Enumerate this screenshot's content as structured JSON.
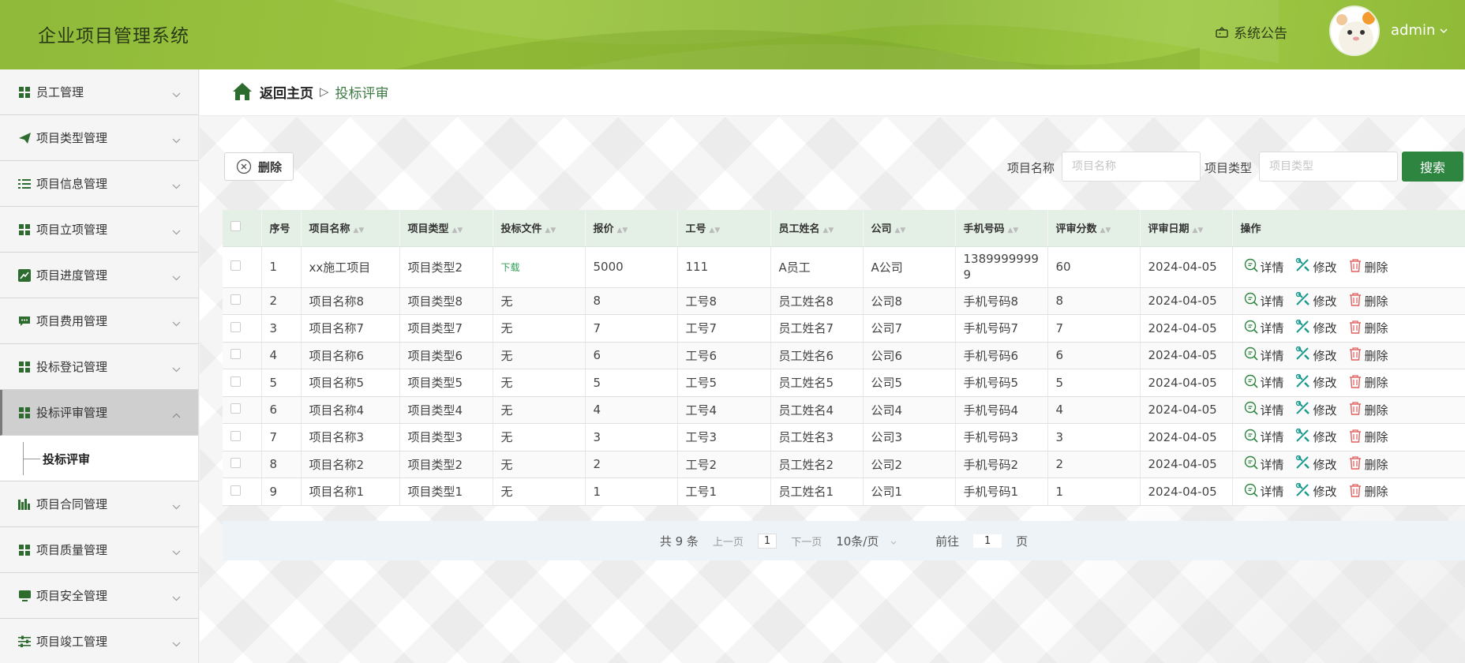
{
  "header": {
    "app_title": "企业项目管理系统",
    "notice": "系统公告",
    "username": "admin"
  },
  "sidebar": {
    "items": [
      {
        "label": "员工管理",
        "icon": "grid-icon"
      },
      {
        "label": "项目类型管理",
        "icon": "paper-plane-icon"
      },
      {
        "label": "项目信息管理",
        "icon": "list-icon"
      },
      {
        "label": "项目立项管理",
        "icon": "grid-icon"
      },
      {
        "label": "项目进度管理",
        "icon": "line-chart-icon"
      },
      {
        "label": "项目费用管理",
        "icon": "chat-icon"
      },
      {
        "label": "投标登记管理",
        "icon": "grid-icon"
      },
      {
        "label": "投标评审管理",
        "icon": "grid-icon"
      },
      {
        "label": "项目合同管理",
        "icon": "bar-chart-icon"
      },
      {
        "label": "项目质量管理",
        "icon": "grid-icon"
      },
      {
        "label": "项目安全管理",
        "icon": "monitor-icon"
      },
      {
        "label": "项目竣工管理",
        "icon": "sliders-icon"
      }
    ],
    "active_submenu": "投标评审"
  },
  "breadcrumb": {
    "home": "返回主页",
    "separator": "▷",
    "current": "投标评审"
  },
  "toolbar": {
    "delete_label": "删除",
    "name_label": "项目名称",
    "name_placeholder": "项目名称",
    "type_label": "项目类型",
    "type_placeholder": "项目类型",
    "search_label": "搜索"
  },
  "table": {
    "columns": [
      "序号",
      "项目名称",
      "项目类型",
      "投标文件",
      "报价",
      "工号",
      "员工姓名",
      "公司",
      "手机号码",
      "评审分数",
      "评审日期",
      "操作"
    ],
    "rows": [
      {
        "no": "1",
        "name": "xx施工项目",
        "type": "项目类型2",
        "file": "下载",
        "price": "5000",
        "job_no": "111",
        "employee": "A员工",
        "company": "A公司",
        "phone": "13899999999",
        "score": "60",
        "date": "2024-04-05"
      },
      {
        "no": "2",
        "name": "项目名称8",
        "type": "项目类型8",
        "file": "无",
        "price": "8",
        "job_no": "工号8",
        "employee": "员工姓名8",
        "company": "公司8",
        "phone": "手机号码8",
        "score": "8",
        "date": "2024-04-05"
      },
      {
        "no": "3",
        "name": "项目名称7",
        "type": "项目类型7",
        "file": "无",
        "price": "7",
        "job_no": "工号7",
        "employee": "员工姓名7",
        "company": "公司7",
        "phone": "手机号码7",
        "score": "7",
        "date": "2024-04-05"
      },
      {
        "no": "4",
        "name": "项目名称6",
        "type": "项目类型6",
        "file": "无",
        "price": "6",
        "job_no": "工号6",
        "employee": "员工姓名6",
        "company": "公司6",
        "phone": "手机号码6",
        "score": "6",
        "date": "2024-04-05"
      },
      {
        "no": "5",
        "name": "项目名称5",
        "type": "项目类型5",
        "file": "无",
        "price": "5",
        "job_no": "工号5",
        "employee": "员工姓名5",
        "company": "公司5",
        "phone": "手机号码5",
        "score": "5",
        "date": "2024-04-05"
      },
      {
        "no": "6",
        "name": "项目名称4",
        "type": "项目类型4",
        "file": "无",
        "price": "4",
        "job_no": "工号4",
        "employee": "员工姓名4",
        "company": "公司4",
        "phone": "手机号码4",
        "score": "4",
        "date": "2024-04-05"
      },
      {
        "no": "7",
        "name": "项目名称3",
        "type": "项目类型3",
        "file": "无",
        "price": "3",
        "job_no": "工号3",
        "employee": "员工姓名3",
        "company": "公司3",
        "phone": "手机号码3",
        "score": "3",
        "date": "2024-04-05"
      },
      {
        "no": "8",
        "name": "项目名称2",
        "type": "项目类型2",
        "file": "无",
        "price": "2",
        "job_no": "工号2",
        "employee": "员工姓名2",
        "company": "公司2",
        "phone": "手机号码2",
        "score": "2",
        "date": "2024-04-05"
      },
      {
        "no": "9",
        "name": "项目名称1",
        "type": "项目类型1",
        "file": "无",
        "price": "1",
        "job_no": "工号1",
        "employee": "员工姓名1",
        "company": "公司1",
        "phone": "手机号码1",
        "score": "1",
        "date": "2024-04-05"
      }
    ],
    "actions": {
      "detail": "详情",
      "edit": "修改",
      "delete": "删除"
    }
  },
  "pager": {
    "total": "共 9 条",
    "prev": "上一页",
    "page": "1",
    "next": "下一页",
    "page_size": "10条/页",
    "goto_label": "前往",
    "goto_value": "1",
    "goto_suffix": "页"
  },
  "colors": {
    "header_green": "#9cc53f",
    "accent_green": "#2e8540",
    "table_header_bg": "#e4f0e6",
    "link_green": "#2e9e5a",
    "edit_teal": "#1a9a8c",
    "delete_red": "#e0605e"
  }
}
